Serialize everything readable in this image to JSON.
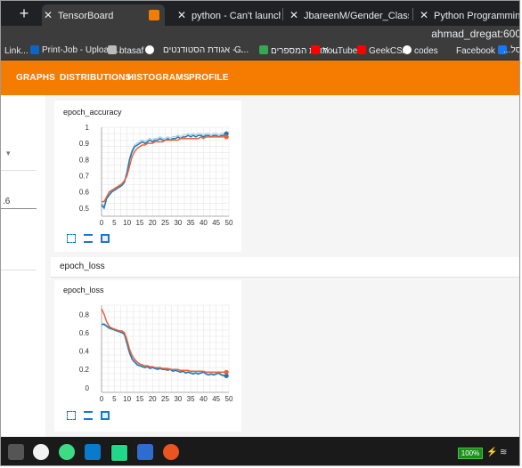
{
  "browser": {
    "new_tab": "+",
    "tabs": [
      {
        "close": "✕",
        "label": "TensorBoard",
        "active": true
      },
      {
        "close": "✕",
        "label": "python - Can't launch TensorBoa",
        "active": false
      },
      {
        "close": "✕",
        "label": "JbareenM/Gender_Classification",
        "active": false
      },
      {
        "close": "✕",
        "label": "Python Programming Tutorials",
        "active": false
      }
    ],
    "url": "ahmad_dregat:600"
  },
  "bookmarks": [
    {
      "label": "Link...",
      "icon": "linkedin-icon"
    },
    {
      "label": "Print-Job - Upload...",
      "icon": "linkedin-icon"
    },
    {
      "label": "btasaf",
      "icon": "car-icon"
    },
    {
      "label": "",
      "icon": "github-icon"
    },
    {
      "label": "אגודת הסטודנטים -...",
      "icon": "dots-icon"
    },
    {
      "label": "G...",
      "icon": "dots-icon"
    },
    {
      "label": "תורת המספרים -...",
      "icon": "drive-icon"
    },
    {
      "label": "YouTube",
      "icon": "youtube-icon"
    },
    {
      "label": "GeekCSA",
      "icon": "youtube-icon"
    },
    {
      "label": "codes",
      "icon": "github-icon"
    },
    {
      "label": "Facebook",
      "icon": "facebook-icon"
    },
    {
      "label": "...רסל",
      "icon": "bookmark-icon"
    }
  ],
  "toolbar": {
    "items": [
      "GRAPHS",
      "DISTRIBUTIONS",
      "HISTOGRAMS",
      "PROFILE"
    ]
  },
  "sidebar": {
    "value": ".6"
  },
  "cards": {
    "accuracy_title": "epoch_accuracy",
    "loss_section": "epoch_loss",
    "loss_title": "epoch_loss"
  },
  "chart_data": [
    {
      "type": "line",
      "title": "epoch_accuracy",
      "xlabel": "",
      "ylabel": "",
      "xlim": [
        0,
        50
      ],
      "ylim": [
        0.45,
        1.0
      ],
      "x_ticks": [
        "0",
        "5",
        "10",
        "15",
        "20",
        "25",
        "30",
        "35",
        "40",
        "45",
        "50"
      ],
      "y_ticks": [
        "0.5",
        "0.6",
        "0.7",
        "0.8",
        "0.9",
        "1"
      ],
      "grid": true,
      "colors": {
        "blue": "#1f77b4",
        "orange": "#e8623a",
        "smooth_blue": "#9ecae1"
      },
      "series": [
        {
          "x": [
            0,
            1,
            2,
            3,
            4,
            5,
            6,
            7,
            8,
            9,
            10,
            11,
            12,
            13,
            14,
            15,
            16,
            17,
            18,
            19,
            20,
            21,
            22,
            23,
            24,
            25,
            26,
            27,
            28,
            29,
            30,
            31,
            32,
            33,
            34,
            35,
            36,
            37,
            38,
            39,
            40,
            41,
            42,
            43,
            44,
            45,
            46,
            47,
            48,
            49
          ],
          "values": [
            0.52,
            0.5,
            0.56,
            0.58,
            0.6,
            0.61,
            0.62,
            0.63,
            0.64,
            0.66,
            0.72,
            0.8,
            0.85,
            0.88,
            0.89,
            0.9,
            0.91,
            0.9,
            0.91,
            0.92,
            0.91,
            0.92,
            0.92,
            0.93,
            0.92,
            0.92,
            0.93,
            0.92,
            0.93,
            0.93,
            0.94,
            0.93,
            0.94,
            0.94,
            0.95,
            0.94,
            0.95,
            0.94,
            0.95,
            0.95,
            0.94,
            0.95,
            0.95,
            0.94,
            0.95,
            0.95,
            0.94,
            0.95,
            0.95,
            0.96
          ]
        },
        {
          "x": [
            0,
            1,
            2,
            3,
            4,
            5,
            6,
            7,
            8,
            9,
            10,
            11,
            12,
            13,
            14,
            15,
            16,
            17,
            18,
            19,
            20,
            21,
            22,
            23,
            24,
            25,
            26,
            27,
            28,
            29,
            30,
            31,
            32,
            33,
            34,
            35,
            36,
            37,
            38,
            39,
            40,
            41,
            42,
            43,
            44,
            45,
            46,
            47,
            48,
            49
          ],
          "values": [
            0.54,
            0.54,
            0.57,
            0.6,
            0.61,
            0.62,
            0.63,
            0.64,
            0.65,
            0.67,
            0.7,
            0.76,
            0.82,
            0.85,
            0.87,
            0.88,
            0.89,
            0.89,
            0.9,
            0.9,
            0.9,
            0.91,
            0.91,
            0.91,
            0.91,
            0.92,
            0.92,
            0.92,
            0.92,
            0.92,
            0.92,
            0.93,
            0.93,
            0.93,
            0.93,
            0.93,
            0.93,
            0.93,
            0.93,
            0.94,
            0.93,
            0.94,
            0.94,
            0.94,
            0.94,
            0.94,
            0.94,
            0.94,
            0.94,
            0.94
          ]
        }
      ]
    },
    {
      "type": "line",
      "title": "epoch_loss",
      "xlabel": "",
      "ylabel": "",
      "xlim": [
        0,
        50
      ],
      "ylim": [
        -0.05,
        0.9
      ],
      "x_ticks": [
        "0",
        "5",
        "10",
        "15",
        "20",
        "25",
        "30",
        "35",
        "40",
        "45",
        "50"
      ],
      "y_ticks": [
        "0",
        "0.2",
        "0.4",
        "0.6",
        "0.8"
      ],
      "grid": true,
      "colors": {
        "blue": "#1f77b4",
        "orange": "#e8623a",
        "smooth_blue": "#9ecae1"
      },
      "series": [
        {
          "x": [
            0,
            1,
            2,
            3,
            4,
            5,
            6,
            7,
            8,
            9,
            10,
            11,
            12,
            13,
            14,
            15,
            16,
            17,
            18,
            19,
            20,
            21,
            22,
            23,
            24,
            25,
            26,
            27,
            28,
            29,
            30,
            31,
            32,
            33,
            34,
            35,
            36,
            37,
            38,
            39,
            40,
            41,
            42,
            43,
            44,
            45,
            46,
            47,
            48,
            49
          ],
          "values": [
            0.69,
            0.69,
            0.67,
            0.65,
            0.64,
            0.63,
            0.62,
            0.61,
            0.6,
            0.58,
            0.48,
            0.38,
            0.31,
            0.28,
            0.25,
            0.24,
            0.23,
            0.22,
            0.23,
            0.21,
            0.22,
            0.21,
            0.2,
            0.21,
            0.2,
            0.2,
            0.19,
            0.2,
            0.18,
            0.19,
            0.18,
            0.17,
            0.18,
            0.16,
            0.17,
            0.16,
            0.15,
            0.16,
            0.15,
            0.16,
            0.17,
            0.15,
            0.14,
            0.15,
            0.14,
            0.15,
            0.16,
            0.14,
            0.13,
            0.13
          ]
        },
        {
          "x": [
            0,
            1,
            2,
            3,
            4,
            5,
            6,
            7,
            8,
            9,
            10,
            11,
            12,
            13,
            14,
            15,
            16,
            17,
            18,
            19,
            20,
            21,
            22,
            23,
            24,
            25,
            26,
            27,
            28,
            29,
            30,
            31,
            32,
            33,
            34,
            35,
            36,
            37,
            38,
            39,
            40,
            41,
            42,
            43,
            44,
            45,
            46,
            47,
            48,
            49
          ],
          "values": [
            0.86,
            0.8,
            0.72,
            0.67,
            0.65,
            0.64,
            0.63,
            0.62,
            0.62,
            0.6,
            0.52,
            0.42,
            0.35,
            0.31,
            0.28,
            0.26,
            0.25,
            0.24,
            0.24,
            0.23,
            0.23,
            0.22,
            0.22,
            0.22,
            0.21,
            0.21,
            0.21,
            0.2,
            0.2,
            0.2,
            0.2,
            0.19,
            0.19,
            0.19,
            0.19,
            0.18,
            0.18,
            0.18,
            0.18,
            0.18,
            0.18,
            0.17,
            0.17,
            0.17,
            0.17,
            0.17,
            0.17,
            0.17,
            0.17,
            0.17
          ]
        }
      ]
    }
  ],
  "taskbar": {
    "battery": "100%",
    "apps": [
      "mail-icon",
      "android-icon",
      "vscode-icon",
      "pycharm-icon",
      "sourcetree-icon",
      "ubuntu-icon"
    ]
  }
}
